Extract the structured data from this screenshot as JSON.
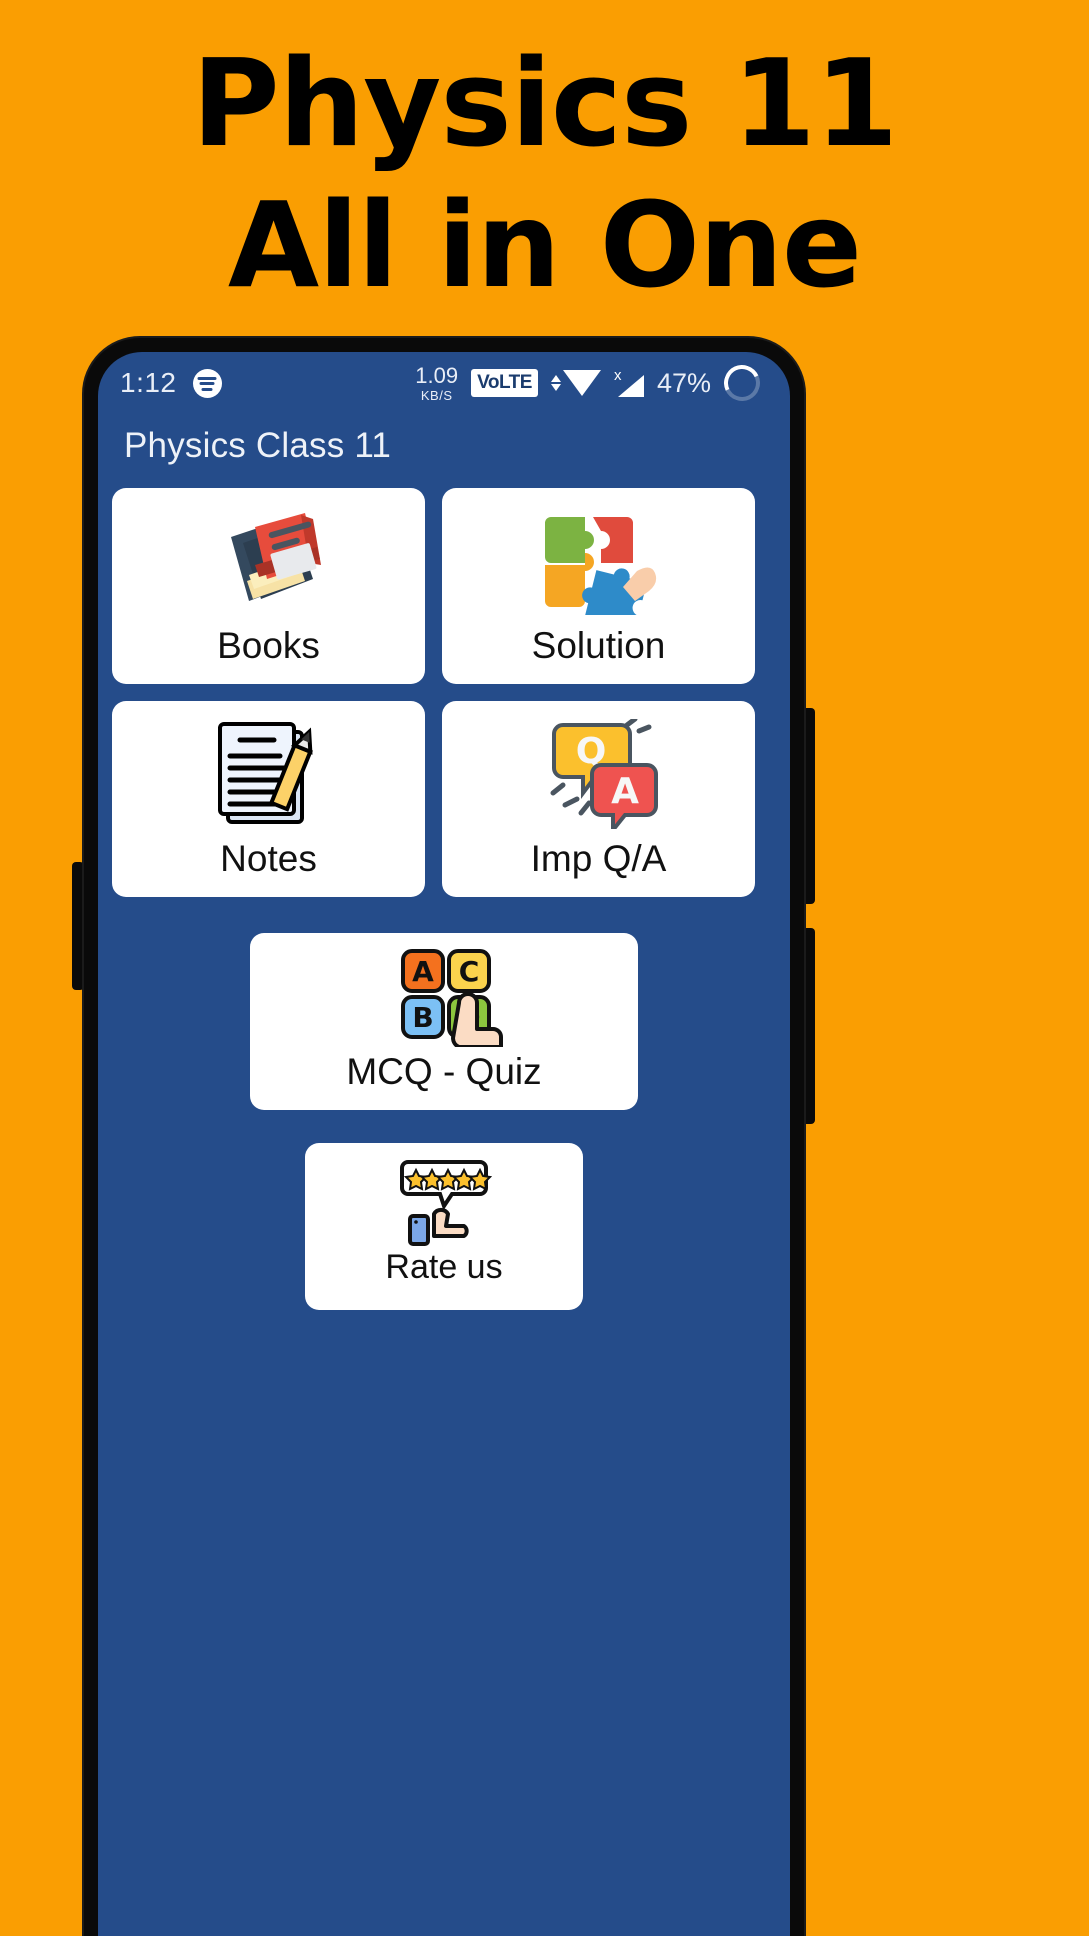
{
  "promo": {
    "line1": "Physics 11",
    "line2": "All in One",
    "bg_color": "#FA9E02",
    "text_color": "#000000"
  },
  "phone": {
    "status_bar": {
      "time": "1:12",
      "notification_icon": "spotify-icon",
      "network_speed_value": "1.09",
      "network_speed_unit": "KB/S",
      "volte_label": "VoLTE",
      "wifi_icon": "wifi-icon",
      "signal_icon": "cellular-signal-no-sim-icon",
      "signal_badge": "x",
      "battery_percent": "47%",
      "battery_icon": "battery-circle-icon"
    },
    "app_bar": {
      "title": "Physics Class 11"
    },
    "theme": {
      "screen_background": "#254C8A",
      "card_background": "#FFFFFF",
      "app_bar_text": "#EEF2F8"
    },
    "menu": {
      "items": [
        {
          "label": "Books",
          "icon": "book-icon"
        },
        {
          "label": "Solution",
          "icon": "puzzle-pieces-icon"
        },
        {
          "label": "Notes",
          "icon": "notepad-pencil-icon"
        },
        {
          "label": "Imp Q/A",
          "icon": "question-answer-bubbles-icon"
        },
        {
          "label": "MCQ - Quiz",
          "icon": "abcd-choice-tap-icon"
        },
        {
          "label": "Rate us",
          "icon": "five-stars-thumbs-up-icon"
        }
      ]
    }
  }
}
